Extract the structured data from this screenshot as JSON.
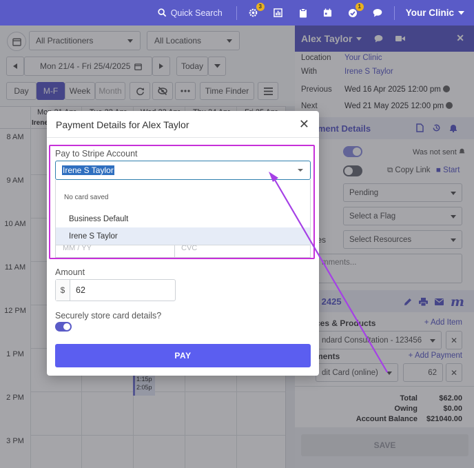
{
  "topbar": {
    "quick_search": "Quick Search",
    "badge_1": "3",
    "badge_2": "1",
    "clinic": "Your Clinic",
    "accent": "#5a5bc7"
  },
  "calendar": {
    "practitioners": "All Practitioners",
    "locations": "All Locations",
    "date_range": "Mon 21/4 - Fri 25/4/2025",
    "today": "Today",
    "views": [
      "Day",
      "M-F",
      "Week",
      "Month"
    ],
    "time_finder": "Time Finder",
    "day_headers": [
      "Mon 21 Apr",
      "Tue 22 Apr",
      "Wed 23 Apr",
      "Thu 24 Apr",
      "Fri 25 Apr"
    ],
    "row_label": "Irene",
    "hours": [
      "8 AM",
      "9 AM",
      "10 AM",
      "11 AM",
      "12 PM",
      "1 PM",
      "2 PM",
      "3 PM"
    ],
    "appointment": {
      "line1": "1:15p",
      "line2": "2:05p"
    }
  },
  "panel": {
    "patient": "Alex Taylor",
    "location_label": "Location",
    "location_value": "Your Clinic",
    "with_label": "With",
    "with_value": "Irene S Taylor",
    "previous_label": "Previous",
    "previous_value": "Wed 16 Apr 2025 12:00 pm",
    "next_label": "Next",
    "next_value": "Wed 21 May 2025 12:00 pm",
    "appt_details": "ointment Details",
    "reminder_label": "nder",
    "reminder_status": "Was not sent",
    "health_label": "ealth",
    "copy_link": "Copy Link",
    "start": "Start",
    "status_value": "Pending",
    "status_label": "s",
    "flag_value": "Select a Flag",
    "resources_label": "ources",
    "resources_value": "Select Resources",
    "comments_placeholder": "mments...",
    "invoice": "ice - 2425",
    "services_label": "ces & Products",
    "add_item": "+ Add Item",
    "service_value": "ndard Consultation - 123456",
    "payments_label": "ments",
    "add_payment": "+ Add Payment",
    "payment_method": "dit Card (online)",
    "payment_amount": "62",
    "total_label": "Total",
    "total_value": "$62.00",
    "owing_label": "Owing",
    "owing_value": "$0.00",
    "balance_label": "Account Balance",
    "balance_value": "$21040.00",
    "save": "SAVE"
  },
  "modal": {
    "title": "Payment Details for Alex Taylor",
    "pay_to_label": "Pay to Stripe Account",
    "selected_account": "Irene S Taylor",
    "group_label": "No card saved",
    "options": [
      "Business Default",
      "Irene S Taylor"
    ],
    "expiry_placeholder": "MM / YY",
    "cvc_placeholder": "CVC",
    "amount_label": "Amount",
    "currency": "$",
    "amount_value": "62",
    "store_label": "Securely store card details?",
    "pay_button": "PAY",
    "highlight_color": "#c630d9",
    "pay_color": "#5b5ef0"
  }
}
